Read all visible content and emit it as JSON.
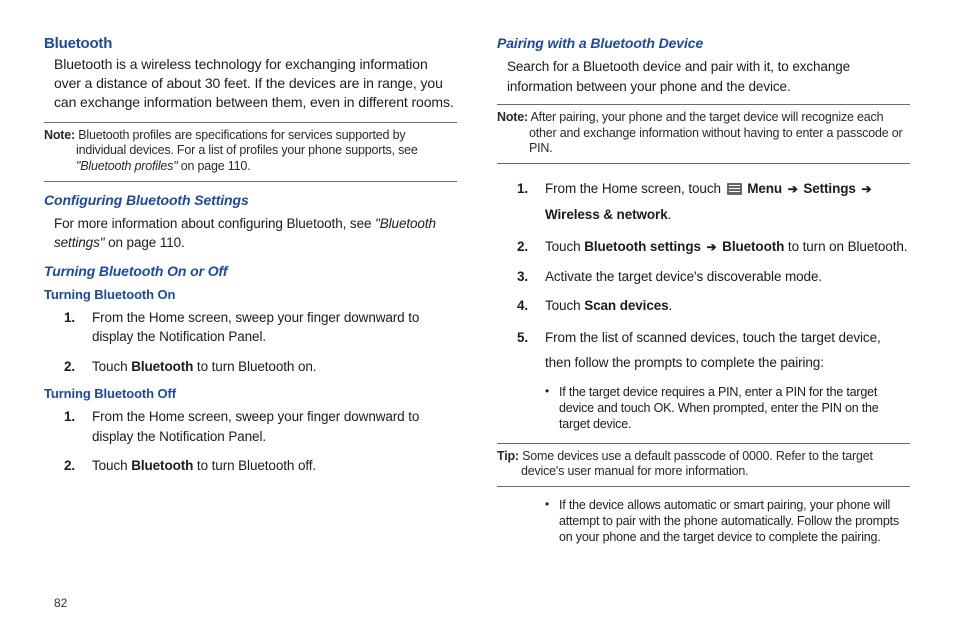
{
  "page_number": "82",
  "left": {
    "h1": "Bluetooth",
    "intro": "Bluetooth is a wireless technology for exchanging information over a distance of about 30 feet. If the devices are in range, you can exchange information between them, even in different rooms.",
    "note1_lead": "Note:",
    "note1_line1": " Bluetooth profiles are specifications for services supported by",
    "note1_line2": "individual devices. For a list of profiles your phone supports, see ",
    "note1_ital": "\"Bluetooth profiles\"",
    "note1_tail": " on page 110.",
    "h2a": "Configuring Bluetooth Settings",
    "config_p1": "For more information about configuring Bluetooth, see ",
    "config_ital": "\"Bluetooth settings\"",
    "config_p2": " on page 110.",
    "h2b": "Turning Bluetooth On or Off",
    "h3a": "Turning Bluetooth On",
    "on_steps": [
      {
        "num": "1.",
        "text_a": "From the Home screen, sweep your finger downward to display the Notification Panel."
      },
      {
        "num": "2.",
        "text_a": "Touch ",
        "kw": "Bluetooth",
        "text_b": " to turn Bluetooth on."
      }
    ],
    "h3b": "Turning Bluetooth Off",
    "off_steps": [
      {
        "num": "1.",
        "text_a": "From the Home screen, sweep your finger downward to display the Notification Panel."
      },
      {
        "num": "2.",
        "text_a": "Touch ",
        "kw": "Bluetooth",
        "text_b": " to turn Bluetooth off."
      }
    ]
  },
  "right": {
    "h2": "Pairing with a Bluetooth Device",
    "intro": "Search for a Bluetooth device and pair with it, to exchange information between your phone and the device.",
    "note1_lead": "Note:",
    "note1_line1": " After pairing, your phone and the target device will recognize each",
    "note1_line2": "other and exchange information without having to enter a passcode or PIN.",
    "steps": {
      "s1": {
        "num": "1.",
        "a": "From the Home screen, touch ",
        "menu": "Menu",
        "arrow1": "➔",
        "settings": "Settings",
        "arrow2": "➔",
        "wn": "Wireless & network",
        "tail": "."
      },
      "s2": {
        "num": "2.",
        "a": "Touch ",
        "bs": "Bluetooth settings",
        "arrow": "➔",
        "bt": "Bluetooth",
        "tail": " to turn on Bluetooth."
      },
      "s3": {
        "num": "3.",
        "a": "Activate the target device's discoverable mode."
      },
      "s4": {
        "num": "4.",
        "a": "Touch ",
        "sd": "Scan devices",
        "tail": "."
      },
      "s5": {
        "num": "5.",
        "a": "From the list of scanned devices, touch the target device, then follow the prompts to complete the pairing:",
        "bullet1": "If the target device requires a PIN, enter a PIN for the target device and touch OK. When prompted, enter the PIN on the target device."
      }
    },
    "tip_lead": "Tip:",
    "tip_line1": " Some devices use a default passcode of 0000. Refer to the target",
    "tip_line2": "device's user manual for more information.",
    "bullet2": "If the device allows automatic or smart pairing, your phone will attempt to pair with the phone automatically. Follow the prompts on your phone and the target device to complete the pairing."
  }
}
